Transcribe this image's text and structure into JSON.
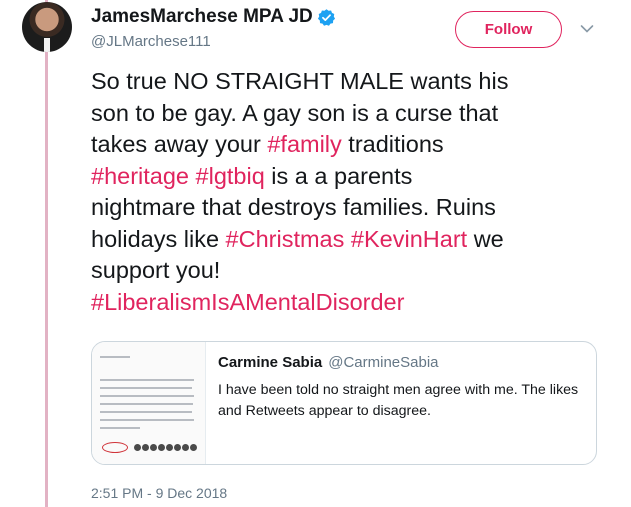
{
  "author": {
    "display_name": "JamesMarchese MPA JD",
    "handle": "@JLMarchese111"
  },
  "follow_label": "Follow",
  "tweet": {
    "lines": [
      [
        {
          "t": "So true NO STRAIGHT MALE wants his",
          "tag": false
        }
      ],
      [
        {
          "t": "son to be gay.  A gay son is a curse that",
          "tag": false
        }
      ],
      [
        {
          "t": "takes away your ",
          "tag": false
        },
        {
          "t": "#family",
          "tag": true
        },
        {
          "t": " traditions",
          "tag": false
        }
      ],
      [
        {
          "t": "#heritage",
          "tag": true
        },
        {
          "t": "  ",
          "tag": false
        },
        {
          "t": "#lgtbiq",
          "tag": true
        },
        {
          "t": " is a a parents",
          "tag": false
        }
      ],
      [
        {
          "t": "nightmare that destroys families.  Ruins",
          "tag": false
        }
      ],
      [
        {
          "t": "holidays like ",
          "tag": false
        },
        {
          "t": "#Christmas",
          "tag": true
        },
        {
          "t": " ",
          "tag": false
        },
        {
          "t": "#KevinHart",
          "tag": true
        },
        {
          "t": " we",
          "tag": false
        }
      ],
      [
        {
          "t": "support you!",
          "tag": false
        }
      ],
      [
        {
          "t": "#LiberalismIsAMentalDisorder",
          "tag": true
        }
      ]
    ]
  },
  "quoted": {
    "display_name": "Carmine Sabia",
    "handle": "@CarmineSabia",
    "text_lines": [
      "I have been told no straight men agree with me. The likes",
      "and Retweets appear to disagree."
    ]
  },
  "timestamp": "2:51 PM - 9 Dec 2018",
  "colors": {
    "accent": "#e0245e",
    "verified": "#1da1f2",
    "thread_line": "#e2b2c4",
    "secondary_text": "#657786"
  },
  "icons": [
    "verified-icon",
    "chevron-down-icon"
  ]
}
